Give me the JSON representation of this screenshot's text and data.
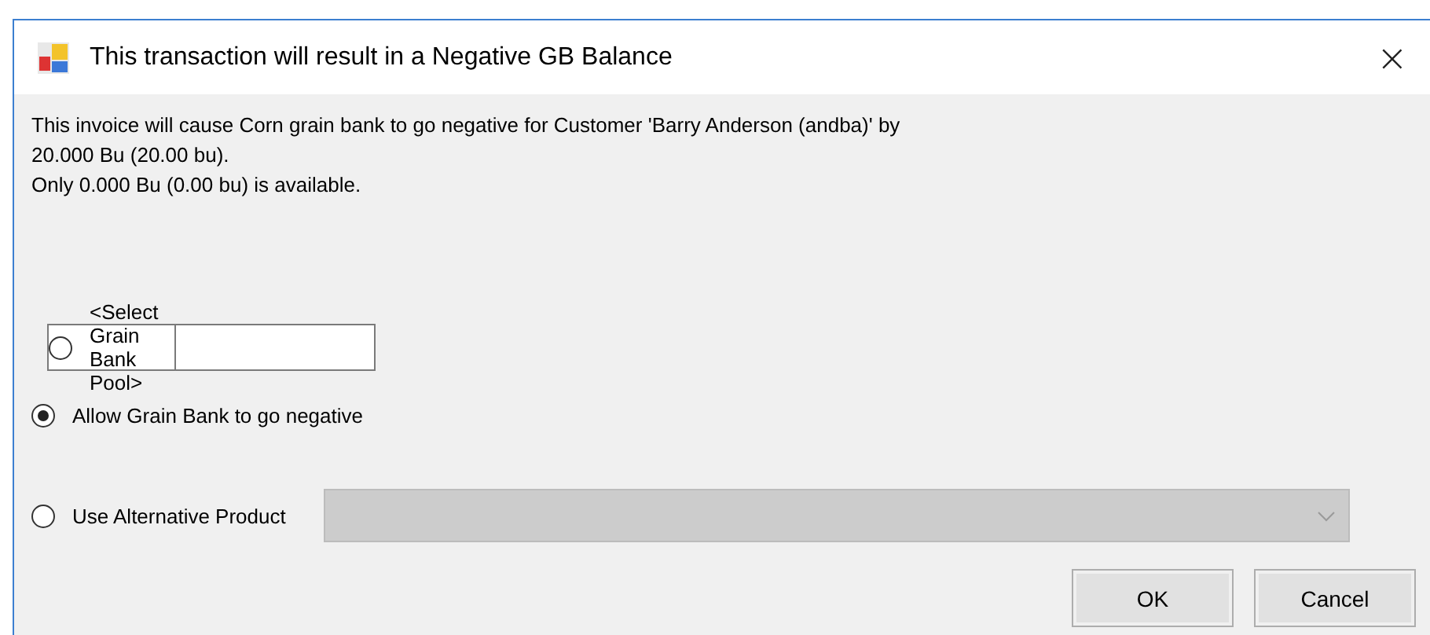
{
  "window": {
    "title": "This transaction will result in a Negative GB Balance",
    "close": "×"
  },
  "message": [
    "This invoice will cause Corn grain bank to go negative for Customer 'Barry Anderson (andba)' by",
    "20.000 Bu (20.00 bu).",
    "Only 0.000 Bu (0.00 bu) is available."
  ],
  "options": [
    {
      "kind": "field",
      "label": "<Select Grain Bank Pool>",
      "selected": false
    },
    {
      "kind": "plain",
      "label": "Allow Grain Bank to go negative",
      "selected": true
    },
    {
      "kind": "dropdown",
      "label": "Use Alternative Product",
      "selected": false,
      "disabled": true
    }
  ],
  "buttons": [
    "OK",
    "Cancel"
  ]
}
